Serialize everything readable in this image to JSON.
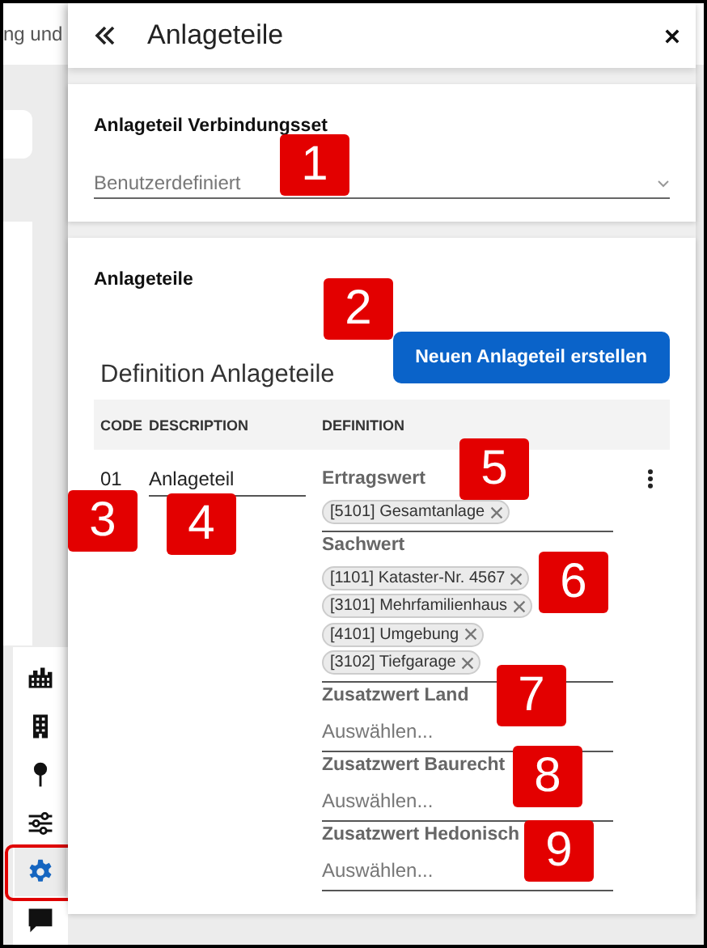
{
  "background": {
    "title_fragment": "ng und"
  },
  "rail": {
    "items": [
      {
        "selected": false
      },
      {
        "selected": false
      },
      {
        "selected": false
      },
      {
        "selected": false
      },
      {
        "selected": true
      },
      {
        "selected": false
      }
    ]
  },
  "drawer": {
    "title": "Anlageteile"
  },
  "connection_set": {
    "label": "Anlageteil Verbindungsset",
    "value": "Benutzerdefiniert"
  },
  "parts": {
    "heading": "Anlageteile",
    "subtitle": "Definition Anlageteile",
    "create_button": "Neuen Anlageteil erstellen",
    "columns": [
      "CODE",
      "DESCRIPTION",
      "DEFINITION"
    ],
    "rows": [
      {
        "code": "01",
        "description": "Anlageteil",
        "definitions": [
          {
            "label": "Ertragswert",
            "chips": [
              "[5101] Gesamtanlage"
            ]
          },
          {
            "label": "Sachwert",
            "chips": [
              "[1101] Kataster-Nr. 4567",
              "[3101] Mehrfamilienhaus",
              "[4101] Umgebung",
              "[3102] Tiefgarage"
            ]
          },
          {
            "label": "Zusatzwert Land",
            "placeholder": "Auswählen..."
          },
          {
            "label": "Zusatzwert Baurecht",
            "placeholder": "Auswählen..."
          },
          {
            "label": "Zusatzwert Hedonisch",
            "placeholder": "Auswählen..."
          }
        ]
      }
    ]
  },
  "callouts": [
    "1",
    "2",
    "3",
    "4",
    "5",
    "6",
    "7",
    "8",
    "9"
  ]
}
